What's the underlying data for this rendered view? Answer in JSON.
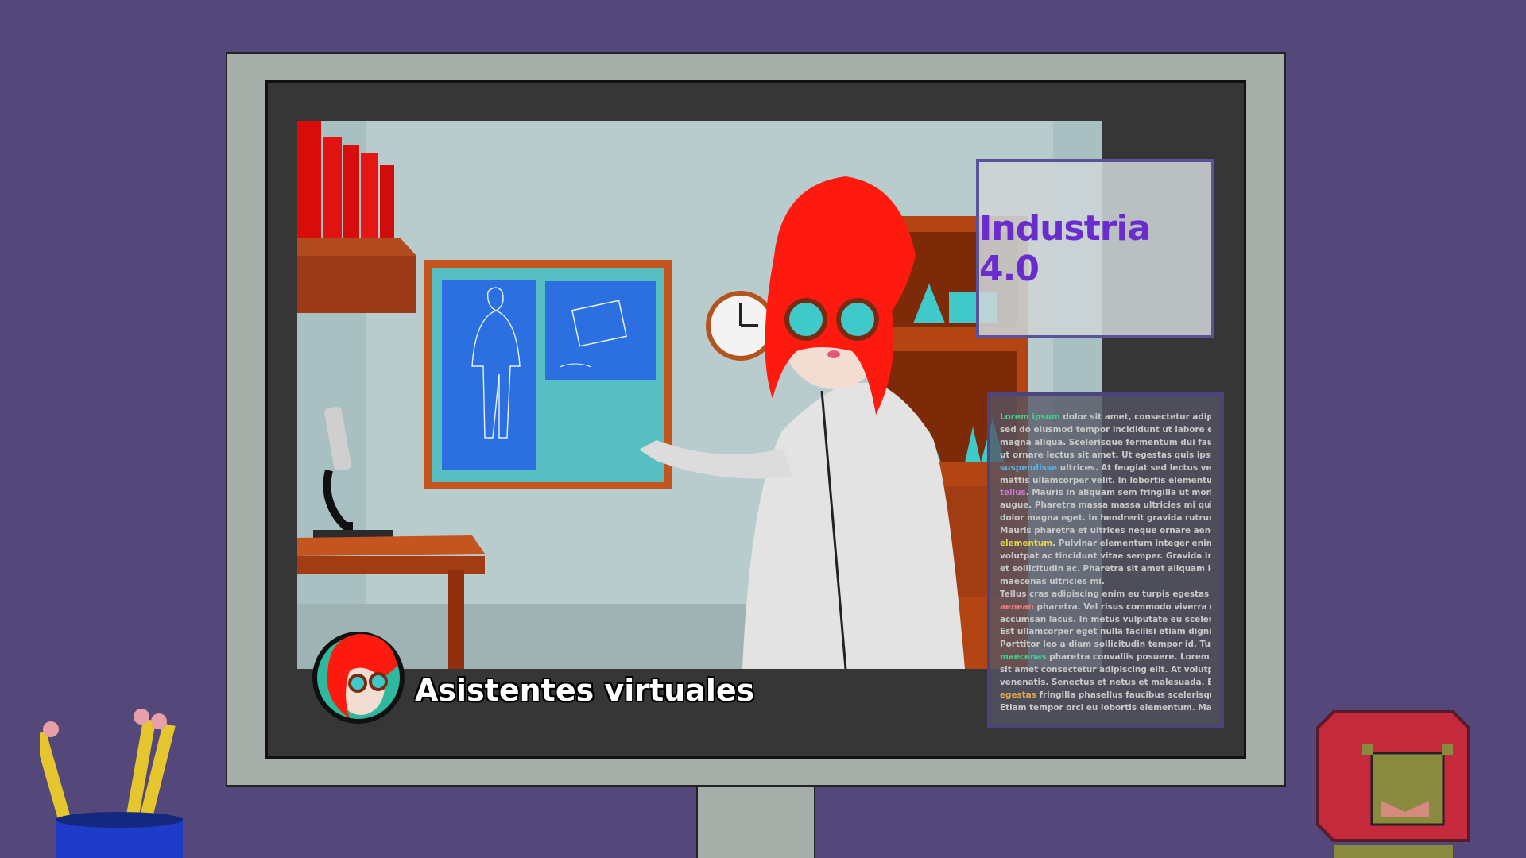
{
  "caption": {
    "text": "Asistentes virtuales"
  },
  "title_panel": {
    "text": "Industria 4.0"
  },
  "text_panel": {
    "lines": [
      {
        "hl": "Lorem ipsum",
        "hl_class": "hl-0",
        "rest": " dolor sit amet, consectetur adipiscing elit,"
      },
      {
        "hl": "",
        "hl_class": "",
        "rest": "sed do eiusmod tempor incididunt ut labore et dolore"
      },
      {
        "hl": "",
        "hl_class": "",
        "rest": "magna aliqua. Scelerisque fermentum dui faucibus in. Dui"
      },
      {
        "hl": "",
        "hl_class": "",
        "rest": "ut ornare lectus sit amet. Ut egestas quis ipsum"
      },
      {
        "hl": "suspendisse",
        "hl_class": "hl-1",
        "rest": " ultrices. At feugiat sed lectus vestibulum"
      },
      {
        "hl": "",
        "hl_class": "",
        "rest": "mattis ullamcorper velit. In lobortis elementum nibh"
      },
      {
        "hl": "tellus",
        "hl_class": "hl-2",
        "rest": ". Mauris in aliquam sem fringilla ut morbi tincidunt"
      },
      {
        "hl": "",
        "hl_class": "",
        "rest": "augue. Pharetra massa massa ultricies mi quis hendrerit"
      },
      {
        "hl": "",
        "hl_class": "",
        "rest": "dolor magna eget. In hendrerit gravida rutrum quisque."
      },
      {
        "hl": "",
        "hl_class": "",
        "rest": "Mauris pharetra et ultrices neque ornare aenean euismod"
      },
      {
        "hl": "elementum",
        "hl_class": "hl-3",
        "rest": ". Pulvinar elementum integer enim neque"
      },
      {
        "hl": "",
        "hl_class": "",
        "rest": "volutpat ac tincidunt vitae semper. Gravida in fermentum"
      },
      {
        "hl": "",
        "hl_class": "",
        "rest": "et sollicitudin ac. Pharetra sit amet aliquam id diam"
      },
      {
        "hl": "",
        "hl_class": "",
        "rest": "maecenas ultricies mi."
      },
      {
        "hl": "",
        "hl_class": "",
        "rest": "Tellus cras adipiscing enim eu turpis egestas pretium"
      },
      {
        "hl": "aenean",
        "hl_class": "hl-4",
        "rest": " pharetra. Vel risus commodo viverra maecenas"
      },
      {
        "hl": "",
        "hl_class": "",
        "rest": "accumsan lacus. In metus vulputate eu scelerisque felis."
      },
      {
        "hl": "",
        "hl_class": "",
        "rest": "Est ullamcorper eget nulla facilisi etiam dignissim."
      },
      {
        "hl": "",
        "hl_class": "",
        "rest": "Porttitor leo a diam sollicitudin tempor id. Turpis egestas"
      },
      {
        "hl": "maecenas",
        "hl_class": "hl-5",
        "rest": " pharetra convallis posuere. Lorem ipsum dolor"
      },
      {
        "hl": "",
        "hl_class": "",
        "rest": "sit amet consectetur adipiscing elit. At volutpat diam ut"
      },
      {
        "hl": "",
        "hl_class": "",
        "rest": "venenatis. Senectus et netus et malesuada. Egestas"
      },
      {
        "hl": "egestas",
        "hl_class": "hl-6",
        "rest": " fringilla phasellus faucibus scelerisque eleifend."
      },
      {
        "hl": "",
        "hl_class": "",
        "rest": "Etiam tempor orci eu lobortis elementum. Mattis rhoncus"
      }
    ]
  },
  "colors": {
    "background": "#544779",
    "title_text": "#6a2ccc",
    "hair": "#ff1a10",
    "goggles": "#3fc9c9"
  }
}
